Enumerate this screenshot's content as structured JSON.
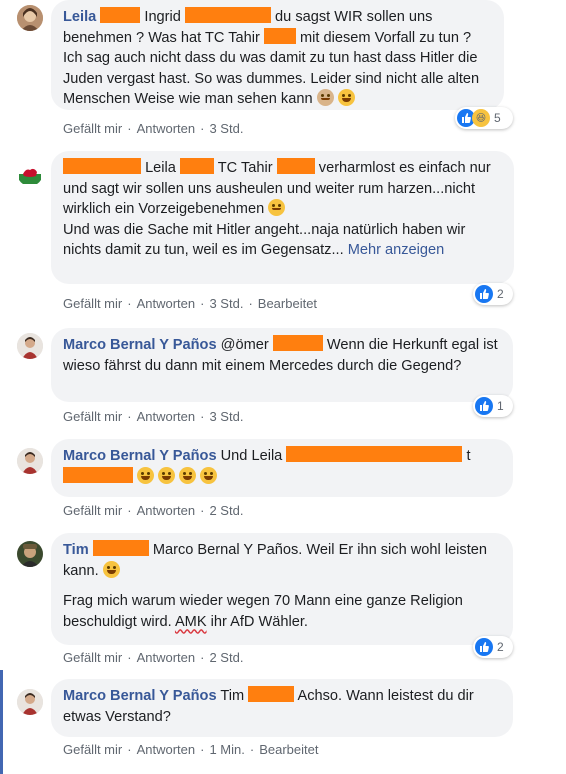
{
  "action_labels": {
    "like": "Gefällt mir",
    "reply": "Antworten",
    "edited": "Bearbeitet",
    "more": "Mehr anzeigen"
  },
  "comments": [
    {
      "author": "Leila",
      "text_parts": [
        "Ingrid",
        "du sagst WIR sollen uns benehmen ? Was hat TC Tahir",
        "mit diesem Vorfall zu tun ? Ich sag auch nicht dass du was damit zu tun hast dass Hitler die Juden vergast hast. So was dummes. Leider sind nicht alle alten Menschen Weise wie man sehen kann"
      ],
      "time": "3 Std.",
      "reactions": {
        "types": [
          "like-icon",
          "haha-icon"
        ],
        "count": "5"
      }
    },
    {
      "author": "",
      "text_parts": [
        "Leila",
        "TC Tahir",
        "verharmlost es einfach nur und sagt wir sollen uns ausheulen und weiter rum harzen...nicht wirklich ein Vorzeigebenehmen",
        "Und was die Sache mit Hitler angeht...naja natürlich haben wir nichts damit zu tun, weil es im Gegensatz..."
      ],
      "time": "3 Std.",
      "edited": true,
      "reactions": {
        "types": [
          "like-icon"
        ],
        "count": "2"
      }
    },
    {
      "author": "Marco Bernal Y Paños",
      "text_parts": [
        "@ömer",
        "Wenn die Herkunft egal ist wieso fährst du dann mit einem Mercedes durch die Gegend?"
      ],
      "time": "3 Std.",
      "reactions": {
        "types": [
          "like-icon"
        ],
        "count": "1"
      }
    },
    {
      "author": "Marco Bernal Y Paños",
      "text_parts": [
        "Und Leila",
        "t"
      ],
      "time": "2 Std."
    },
    {
      "author": "Tim",
      "text_parts": [
        "Marco Bernal Y Paños. Weil Er ihn sich wohl leisten kann.",
        "Frag mich warum wieder wegen 70 Mann eine ganze Religion beschuldigt wird.",
        "AMK",
        "ihr AfD Wähler."
      ],
      "time": "2 Std.",
      "reactions": {
        "types": [
          "like-icon"
        ],
        "count": "2"
      }
    },
    {
      "author": "Marco Bernal Y Paños",
      "text_parts": [
        "Tim",
        "Achso. Wann leistest du dir etwas Verstand?"
      ],
      "time": "1 Min.",
      "edited": true
    }
  ]
}
